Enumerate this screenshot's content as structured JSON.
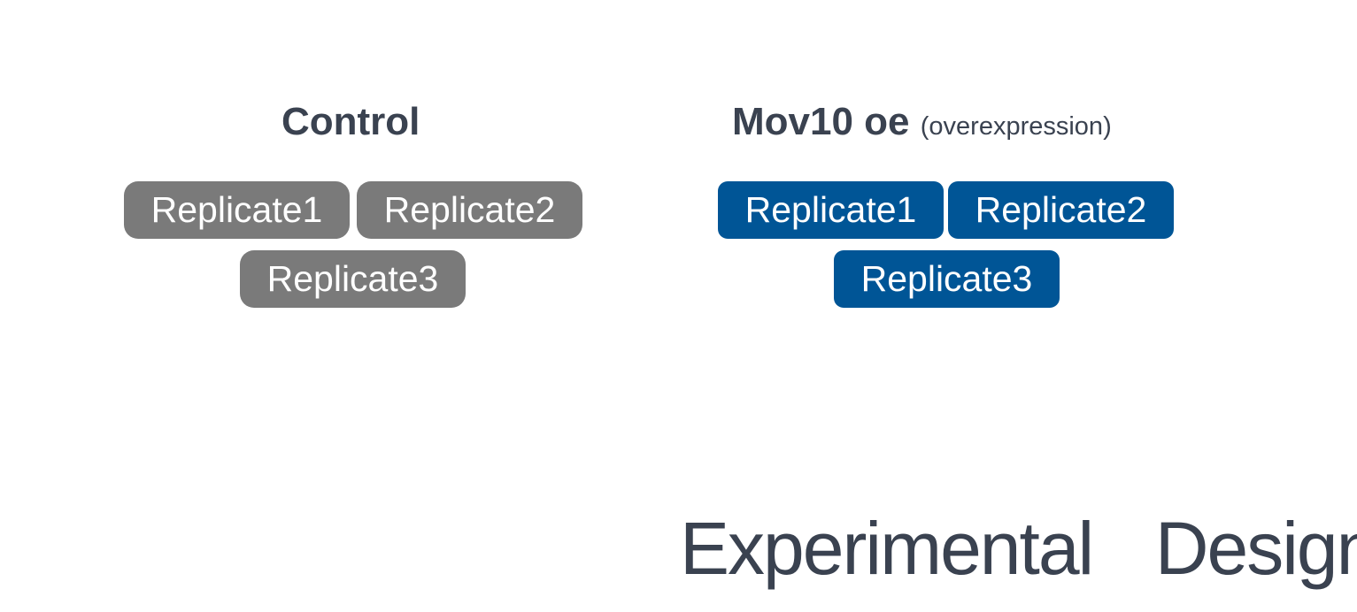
{
  "control": {
    "title": "Control",
    "replicates": [
      "Replicate1",
      "Replicate2",
      "Replicate3"
    ],
    "color": "#7a7a7a"
  },
  "treatment": {
    "title": "Mov10 oe",
    "subtitle": "(overexpression)",
    "replicates": [
      "Replicate1",
      "Replicate2",
      "Replicate3"
    ],
    "color": "#005596"
  },
  "slide_title": "Experimental  Design"
}
